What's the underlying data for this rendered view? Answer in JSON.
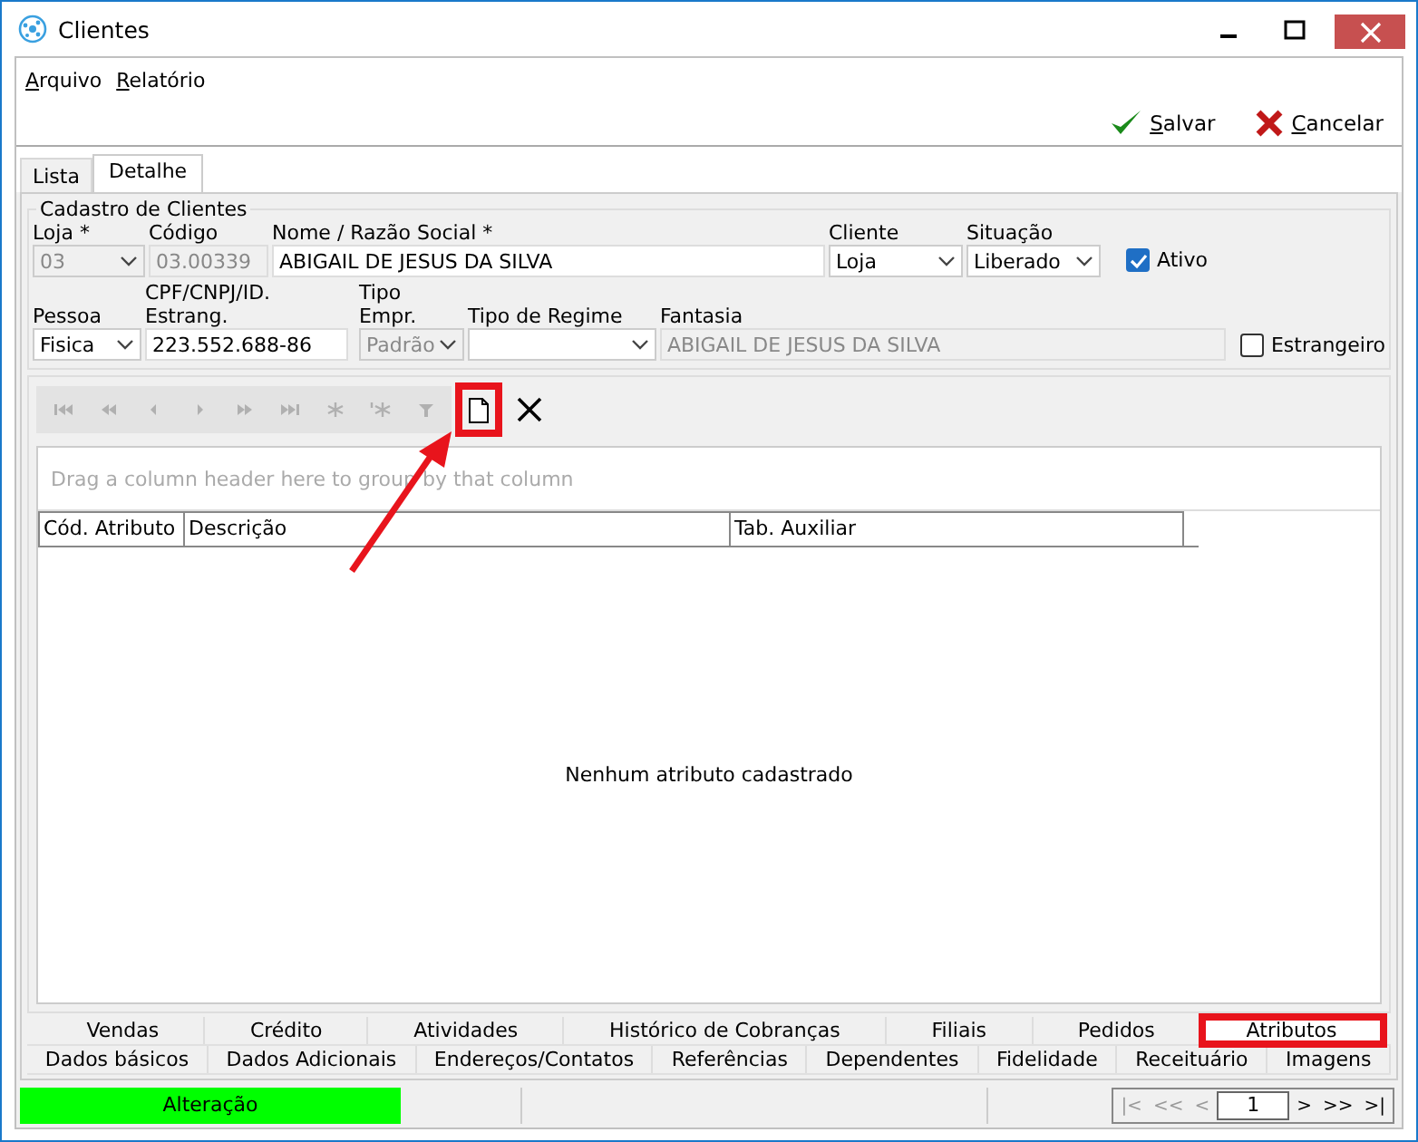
{
  "window": {
    "title": "Clientes"
  },
  "menu": [
    {
      "label": "Arquivo"
    },
    {
      "label": "Relatório"
    }
  ],
  "actions": [
    {
      "kind": "save",
      "label": "Salvar"
    },
    {
      "kind": "cancel",
      "label": "Cancelar"
    }
  ],
  "tabs": [
    {
      "label": "Lista",
      "selected": false
    },
    {
      "label": "Detalhe",
      "selected": true
    }
  ],
  "group": {
    "title": "Cadastro de Clientes",
    "row1": [
      {
        "label": "Loja *",
        "value": "03",
        "kind": "combo",
        "disabled": true
      },
      {
        "label": "Código",
        "value": "03.00339",
        "kind": "text",
        "disabled": true
      },
      {
        "label": "Nome / Razão Social *",
        "value": "ABIGAIL DE JESUS DA SILVA",
        "kind": "text",
        "disabled": false
      },
      {
        "label": "Cliente",
        "value": "Loja",
        "kind": "combo",
        "disabled": false
      },
      {
        "label": "Situação",
        "value": "Liberado",
        "kind": "combo",
        "disabled": false
      }
    ],
    "ativo": {
      "label": "Ativo",
      "checked": true
    },
    "row2": [
      {
        "label": "Pessoa",
        "value": "Fisica",
        "kind": "combo",
        "disabled": false
      },
      {
        "label": "CPF/CNPJ/ID. Estrang.",
        "value": "223.552.688-86",
        "kind": "text",
        "disabled": false
      },
      {
        "label": "Tipo Empr.",
        "value": "Padrão",
        "kind": "combo",
        "disabled": true
      },
      {
        "label": "Tipo de Regime",
        "kind": "combo",
        "disabled": false
      },
      {
        "label": "Fantasia",
        "value": "ABIGAIL DE JESUS DA SILVA",
        "kind": "text",
        "disabled": true
      }
    ],
    "estrangeiro": {
      "label": "Estrangeiro",
      "checked": false
    }
  },
  "navigator": [
    {
      "kind": "first",
      "disabled": true
    },
    {
      "kind": "prev-page",
      "disabled": true
    },
    {
      "kind": "prev",
      "disabled": true
    },
    {
      "kind": "next",
      "disabled": true
    },
    {
      "kind": "next-page",
      "disabled": true
    },
    {
      "kind": "last",
      "disabled": true
    },
    {
      "kind": "insert",
      "disabled": true
    },
    {
      "kind": "append",
      "disabled": true
    },
    {
      "kind": "filter",
      "disabled": true
    },
    {
      "kind": "new",
      "highlighted": true
    },
    {
      "kind": "delete",
      "highlighted": false
    }
  ],
  "grid": {
    "group_hint": "Drag a column header here to group by that column",
    "columns": [
      "Cód. Atributo",
      "Descrição",
      "Tab. Auxiliar"
    ],
    "empty_text": "Nenhum atributo cadastrado"
  },
  "bottom_tabs": [
    [
      {
        "label": "Vendas",
        "selected": false,
        "highlighted": false
      },
      {
        "label": "Crédito",
        "selected": false,
        "highlighted": false
      },
      {
        "label": "Atividades",
        "selected": false,
        "highlighted": false
      },
      {
        "label": "Histórico de Cobranças",
        "selected": false,
        "highlighted": false
      },
      {
        "label": "Filiais",
        "selected": false,
        "highlighted": false
      },
      {
        "label": "Pedidos",
        "selected": false,
        "highlighted": false
      },
      {
        "label": "Atributos",
        "selected": true,
        "highlighted": true
      }
    ],
    [
      {
        "label": "Dados básicos",
        "selected": false,
        "highlighted": false
      },
      {
        "label": "Dados Adicionais",
        "selected": false,
        "highlighted": false
      },
      {
        "label": "Endereços/Contatos",
        "selected": false,
        "highlighted": false
      },
      {
        "label": "Referências",
        "selected": false,
        "highlighted": false
      },
      {
        "label": "Dependentes",
        "selected": false,
        "highlighted": false
      },
      {
        "label": "Fidelidade",
        "selected": false,
        "highlighted": false
      },
      {
        "label": "Receituário",
        "selected": false,
        "highlighted": false
      },
      {
        "label": "Imagens",
        "selected": false,
        "highlighted": false
      }
    ]
  ],
  "status_bar": {
    "mode": "Alteração",
    "pager": [
      "|<",
      "<<",
      "<",
      "1",
      ">",
      ">>",
      ">|"
    ]
  }
}
